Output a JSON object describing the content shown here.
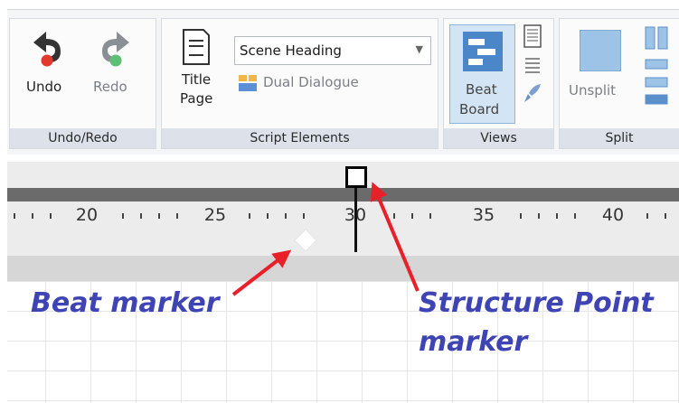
{
  "ribbon": {
    "undo_redo": {
      "group_label": "Undo/Redo",
      "undo_label": "Undo",
      "redo_label": "Redo",
      "undo_icon": "undo-icon",
      "redo_icon": "redo-icon"
    },
    "script_elements": {
      "group_label": "Script Elements",
      "title_page_line1": "Title",
      "title_page_line2": "Page",
      "element_select_value": "Scene Heading",
      "dual_dialogue_label": "Dual Dialogue"
    },
    "views": {
      "group_label": "Views",
      "beat_board_line1": "Beat",
      "beat_board_line2": "Board"
    },
    "split": {
      "group_label": "Split",
      "unsplit_label": "Unsplit"
    }
  },
  "ruler": {
    "labels": [
      "20",
      "25",
      "30",
      "35",
      "40"
    ]
  },
  "annotations": {
    "beat_marker": "Beat marker",
    "structure_point_line1": "Structure Point",
    "structure_point_line2": "marker",
    "arrow_color": "#e8202a",
    "text_color": "#3f44b4"
  },
  "colors": {
    "accent_blue": "#4a86c8",
    "beat_board_highlight": "#d3e4f5"
  }
}
